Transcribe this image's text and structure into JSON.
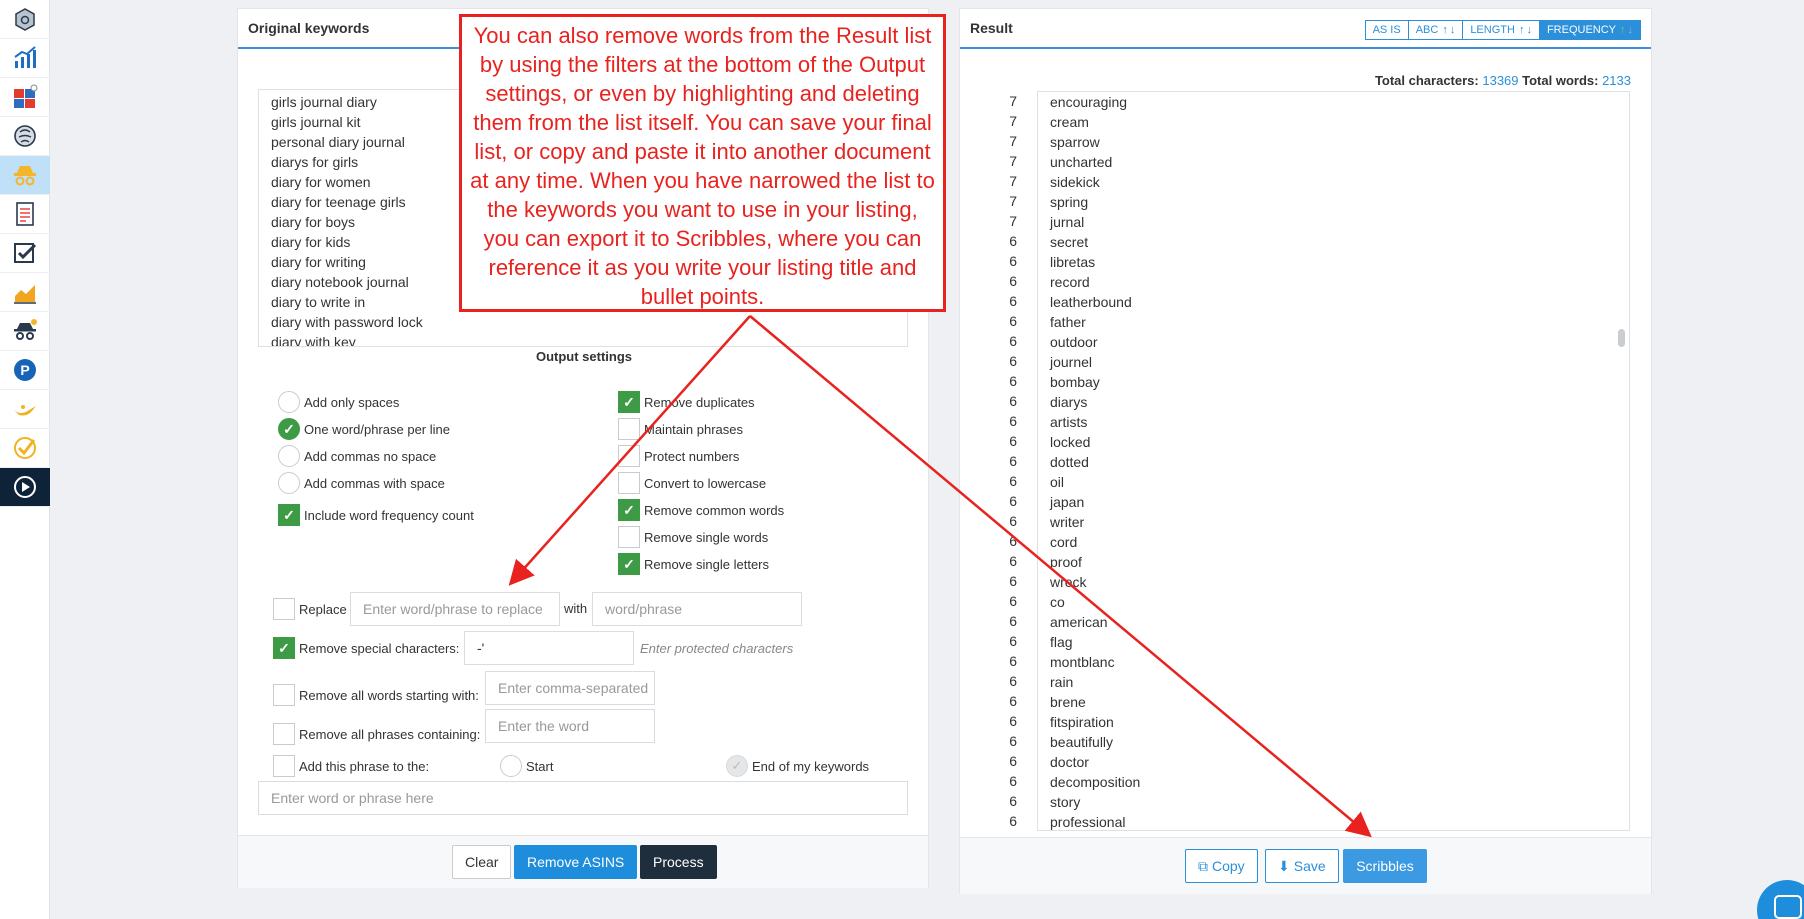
{
  "rail": {
    "items": [
      {
        "name": "cube-icon",
        "active": false
      },
      {
        "name": "chart-growth-icon",
        "active": false
      },
      {
        "name": "puzzle-icon",
        "active": false
      },
      {
        "name": "brain-icon",
        "active": false
      },
      {
        "name": "spy-hat-icon",
        "active": true
      },
      {
        "name": "document-list-icon",
        "active": false
      },
      {
        "name": "checklist-icon",
        "active": false
      },
      {
        "name": "area-chart-icon",
        "active": false
      },
      {
        "name": "incognito-alert-icon",
        "active": false
      },
      {
        "name": "p-circle-icon",
        "active": false
      },
      {
        "name": "lamp-icon",
        "active": false
      },
      {
        "name": "check-badge-icon",
        "active": false
      },
      {
        "name": "play-circle-icon",
        "active": false
      }
    ]
  },
  "original": {
    "title": "Original keywords",
    "keywords": [
      "girls journal diary",
      "girls journal kit",
      "personal diary journal",
      "diarys for girls",
      "diary for women",
      "diary for teenage girls",
      "diary for boys",
      "diary for kids",
      "diary for writing",
      "diary notebook journal",
      "diary to write in",
      "diary with password lock",
      "diary with key"
    ]
  },
  "output": {
    "title": "Output settings",
    "left_options": [
      {
        "label": "Add only spaces",
        "checked": false
      },
      {
        "label": "One word/phrase per line",
        "checked": true
      },
      {
        "label": "Add commas no space",
        "checked": false
      },
      {
        "label": "Add commas with space",
        "checked": false
      }
    ],
    "frequency_option": {
      "label": "Include word frequency count",
      "checked": true
    },
    "right_options": [
      {
        "label": "Remove duplicates",
        "checked": true
      },
      {
        "label": "Maintain phrases",
        "checked": false
      },
      {
        "label": "Protect numbers",
        "checked": false
      },
      {
        "label": "Convert to lowercase",
        "checked": false
      },
      {
        "label": "Remove common words",
        "checked": true
      },
      {
        "label": "Remove single words",
        "checked": false
      },
      {
        "label": "Remove single letters",
        "checked": true
      }
    ],
    "replace": {
      "label": "Replace",
      "placeholder": "Enter word/phrase to replace",
      "with": "with",
      "with_placeholder": "word/phrase",
      "checked": false
    },
    "special": {
      "label": "Remove special characters:",
      "value": "-'",
      "hint": "Enter protected characters",
      "checked": true
    },
    "starting": {
      "label": "Remove all words starting with:",
      "placeholder": "Enter comma-separated",
      "checked": false
    },
    "containing": {
      "label": "Remove all phrases containing:",
      "placeholder": "Enter the word",
      "checked": false
    },
    "add_phrase": {
      "label": "Add this phrase to the:",
      "start": "Start",
      "end": "End of my keywords",
      "checked": false
    },
    "phrase_placeholder": "Enter word or phrase here"
  },
  "left_buttons": {
    "clear": "Clear",
    "remove_asins": "Remove ASINS",
    "process": "Process"
  },
  "result": {
    "title": "Result",
    "sort": {
      "as_is": "AS IS",
      "abc": "ABC",
      "length": "LENGTH",
      "frequency": "FREQUENCY"
    },
    "total_characters_label": "Total characters:",
    "total_characters": "13369",
    "total_words_label": "Total words:",
    "total_words": "2133",
    "rows": [
      {
        "freq": "7",
        "word": "encouraging"
      },
      {
        "freq": "7",
        "word": "cream"
      },
      {
        "freq": "7",
        "word": "sparrow"
      },
      {
        "freq": "7",
        "word": "uncharted"
      },
      {
        "freq": "7",
        "word": "sidekick"
      },
      {
        "freq": "7",
        "word": "spring"
      },
      {
        "freq": "7",
        "word": "jurnal"
      },
      {
        "freq": "6",
        "word": "secret"
      },
      {
        "freq": "6",
        "word": "libretas"
      },
      {
        "freq": "6",
        "word": "record"
      },
      {
        "freq": "6",
        "word": "leatherbound"
      },
      {
        "freq": "6",
        "word": "father"
      },
      {
        "freq": "6",
        "word": "outdoor"
      },
      {
        "freq": "6",
        "word": "journel"
      },
      {
        "freq": "6",
        "word": "bombay"
      },
      {
        "freq": "6",
        "word": "diarys"
      },
      {
        "freq": "6",
        "word": "artists"
      },
      {
        "freq": "6",
        "word": "locked"
      },
      {
        "freq": "6",
        "word": "dotted"
      },
      {
        "freq": "6",
        "word": "oil"
      },
      {
        "freq": "6",
        "word": "japan"
      },
      {
        "freq": "6",
        "word": "writer"
      },
      {
        "freq": "6",
        "word": "cord"
      },
      {
        "freq": "6",
        "word": "proof"
      },
      {
        "freq": "6",
        "word": "wreck"
      },
      {
        "freq": "6",
        "word": "co"
      },
      {
        "freq": "6",
        "word": "american"
      },
      {
        "freq": "6",
        "word": "flag"
      },
      {
        "freq": "6",
        "word": "montblanc"
      },
      {
        "freq": "6",
        "word": "rain"
      },
      {
        "freq": "6",
        "word": "brene"
      },
      {
        "freq": "6",
        "word": "fitspiration"
      },
      {
        "freq": "6",
        "word": "beautifully"
      },
      {
        "freq": "6",
        "word": "doctor"
      },
      {
        "freq": "6",
        "word": "decomposition"
      },
      {
        "freq": "6",
        "word": "story"
      },
      {
        "freq": "6",
        "word": "professional"
      }
    ],
    "buttons": {
      "copy": "Copy",
      "save": "Save",
      "scribbles": "Scribbles"
    }
  },
  "annotation": "You can also remove words from the Result list by using the filters at the bottom of the Output settings, or even by highlighting and deleting them from the list itself. You can save your final list, or copy and paste it into another document at any time. When you have narrowed the list to the keywords you want to use in your listing, you can export it to Scribbles, where you can reference it as you write your listing title and bullet points.",
  "colors": {
    "accent": "#2b8fd9",
    "check": "#3d9b46",
    "annotation": "#e8231f",
    "dark": "#1f2e3d"
  }
}
